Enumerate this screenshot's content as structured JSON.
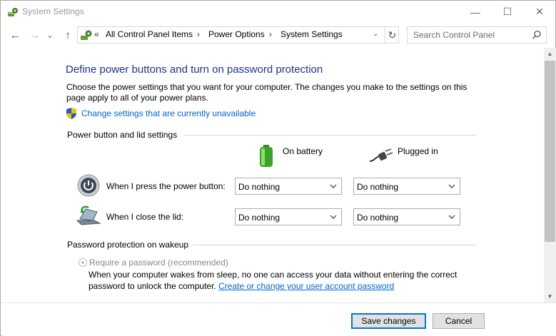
{
  "window": {
    "title": "System Settings",
    "controls": {
      "minimize": "—",
      "maximize": "☐",
      "close": "✕"
    }
  },
  "nav": {
    "back": "←",
    "forward": "→",
    "recent": "⌄",
    "up": "↑",
    "address_prefix": "«",
    "breadcrumbs": [
      "All Control Panel Items",
      "Power Options",
      "System Settings"
    ],
    "separator": "›",
    "dropdown": "⌄",
    "refresh": "↻"
  },
  "search": {
    "placeholder": "Search Control Panel"
  },
  "main": {
    "heading": "Define power buttons and turn on password protection",
    "description": "Choose the power settings that you want for your computer. The changes you make to the settings on this page apply to all of your power plans.",
    "change_link": "Change settings that are currently unavailable",
    "power_group": {
      "title": "Power button and lid settings",
      "col_battery": "On battery",
      "col_plugged": "Plugged in",
      "rows": [
        {
          "label": "When I press the power button:",
          "battery": "Do nothing",
          "plugged": "Do nothing"
        },
        {
          "label": "When I close the lid:",
          "battery": "Do nothing",
          "plugged": "Do nothing"
        }
      ]
    },
    "password_group": {
      "title": "Password protection on wakeup",
      "option_label": "Require a password (recommended)",
      "option_desc": "When your computer wakes from sleep, no one can access your data without entering the correct password to unlock the computer.",
      "option_link": "Create or change your user account password"
    }
  },
  "footer": {
    "save": "Save changes",
    "cancel": "Cancel"
  },
  "colors": {
    "heading": "#1e3287",
    "link": "#0066cc",
    "primary_border": "#0078d7"
  }
}
